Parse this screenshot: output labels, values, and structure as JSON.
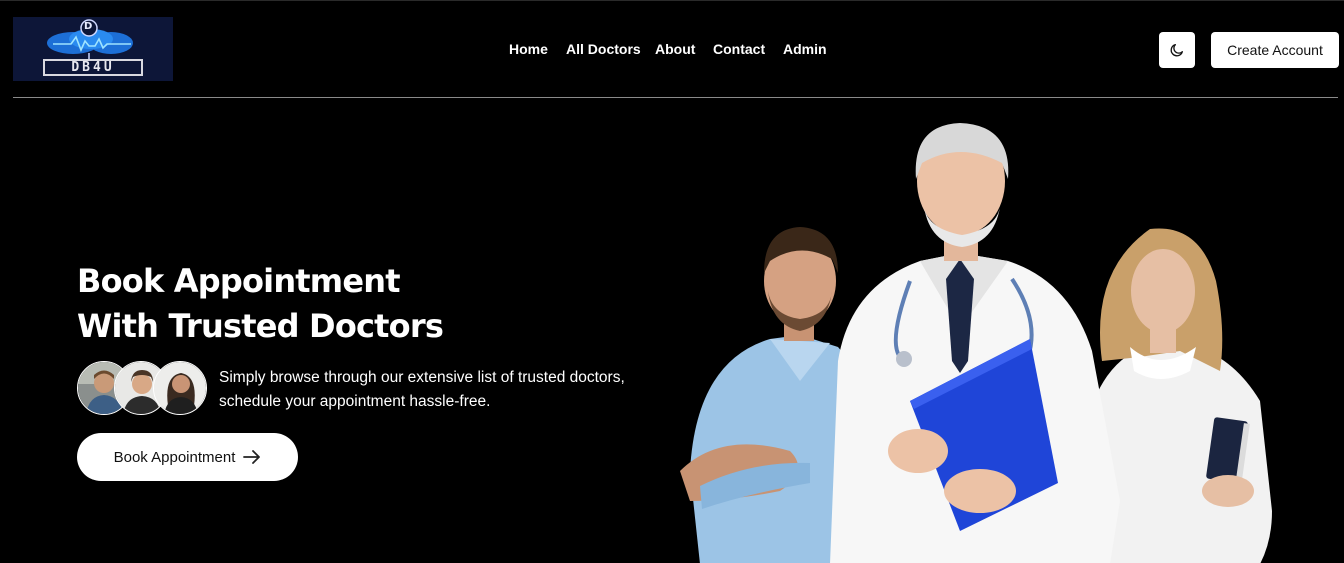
{
  "header": {
    "logo_text": "DB4U",
    "logo_letter": "D",
    "nav": [
      "Home",
      "All Doctors",
      "About",
      "Contact",
      "Admin"
    ],
    "create_account": "Create Account"
  },
  "hero": {
    "title_line1": "Book Appointment",
    "title_line2": "With Trusted Doctors",
    "description_line1": "Simply browse through our extensive list of trusted doctors,",
    "description_line2": "schedule your appointment hassle-free.",
    "cta_label": "Book Appointment"
  },
  "icons": {
    "theme": "moon-icon",
    "cta": "arrow-right-icon"
  },
  "colors": {
    "background": "#000000",
    "accent": "#ffffff",
    "logo_bg": "#0d1638",
    "clipboard": "#1f45d8"
  }
}
